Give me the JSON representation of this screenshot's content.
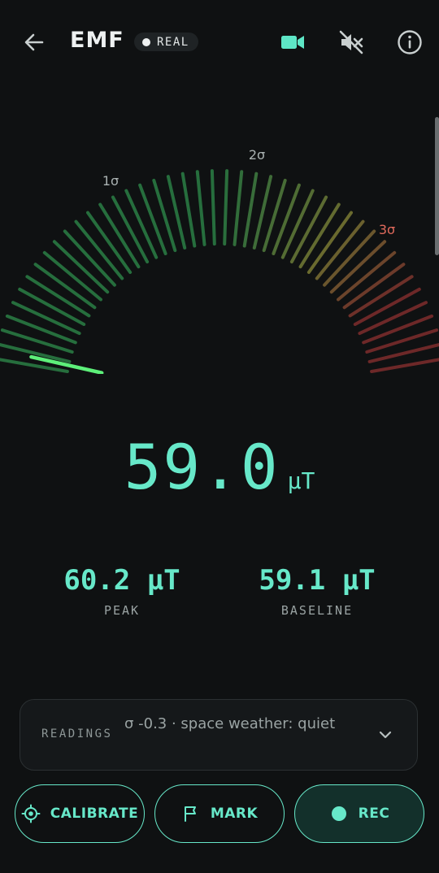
{
  "header": {
    "title": "EMF",
    "mode_badge": "REAL",
    "icons": {
      "back": "arrow-left-icon",
      "camera": "video-camera-icon",
      "sound": "volume-off-icon",
      "info": "info-icon"
    }
  },
  "gauge": {
    "labels": {
      "sigma1": "1σ",
      "sigma2": "2σ",
      "sigma3": "3σ"
    },
    "colors": {
      "green": "#2b7f45",
      "yellow": "#7a7a34",
      "red": "#7e2d2d",
      "needle": "#5df07a"
    },
    "needle_level": 0.02
  },
  "reading": {
    "value": "59.0",
    "unit": "µT"
  },
  "stats": {
    "peak": {
      "value": "60.2 µT",
      "label": "PEAK"
    },
    "baseline": {
      "value": "59.1 µT",
      "label": "BASELINE"
    }
  },
  "readings_card": {
    "label": "READINGS",
    "text": "σ  -0.3 · space weather: quiet"
  },
  "buttons": {
    "calibrate": "CALIBRATE",
    "mark": "MARK",
    "rec": "REC"
  },
  "colors": {
    "accent": "#67e8c9",
    "background": "#0f1112"
  }
}
